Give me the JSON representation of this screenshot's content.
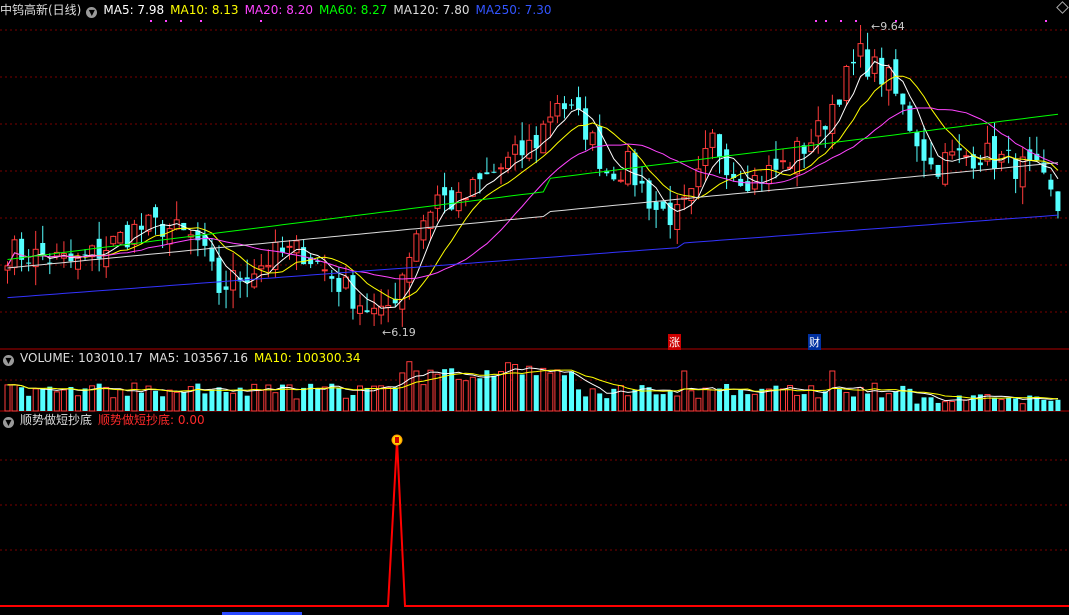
{
  "main_header": {
    "title": "中钨高新(日线)",
    "ma5": "MA5: 7.98",
    "ma10": "MA10: 8.13",
    "ma20": "MA20: 8.20",
    "ma60": "MA60: 8.27",
    "ma120": "MA120: 7.80",
    "ma250": "MA250: 7.30"
  },
  "volume_header": {
    "label": "VOLUME: 103010.17",
    "ma5": "MA5: 103567.16",
    "ma10": "MA10: 100300.34"
  },
  "indicator_header": {
    "name": "顺势做短抄底",
    "value_label": "顺势做短抄底: 0.00"
  },
  "annotations": {
    "high": "9.64",
    "low": "6.19",
    "event_zhang": "涨",
    "event_cai": "财"
  },
  "colors": {
    "up": "#ff3b3b",
    "down": "#54ffff",
    "ma5": "#ffffff",
    "ma10": "#ffff00",
    "ma20": "#ff44ff",
    "ma60": "#00ff00",
    "ma120": "#dddddd",
    "ma250": "#3333ff",
    "grid": "#7a0000",
    "indicator": "#ff0000"
  },
  "icons": {
    "menu": "circle-caret-icon",
    "corner": "diamond-icon"
  },
  "chart_data": {
    "type": "candlestick",
    "price_range": [
      6.0,
      9.8
    ],
    "high": 9.64,
    "low": 6.19,
    "ma_last": {
      "MA5": 7.98,
      "MA10": 8.13,
      "MA20": 8.2,
      "MA60": 8.27,
      "MA120": 7.8,
      "MA250": 7.3
    },
    "volume_last": 103010.17,
    "indicator_last": 0.0
  }
}
